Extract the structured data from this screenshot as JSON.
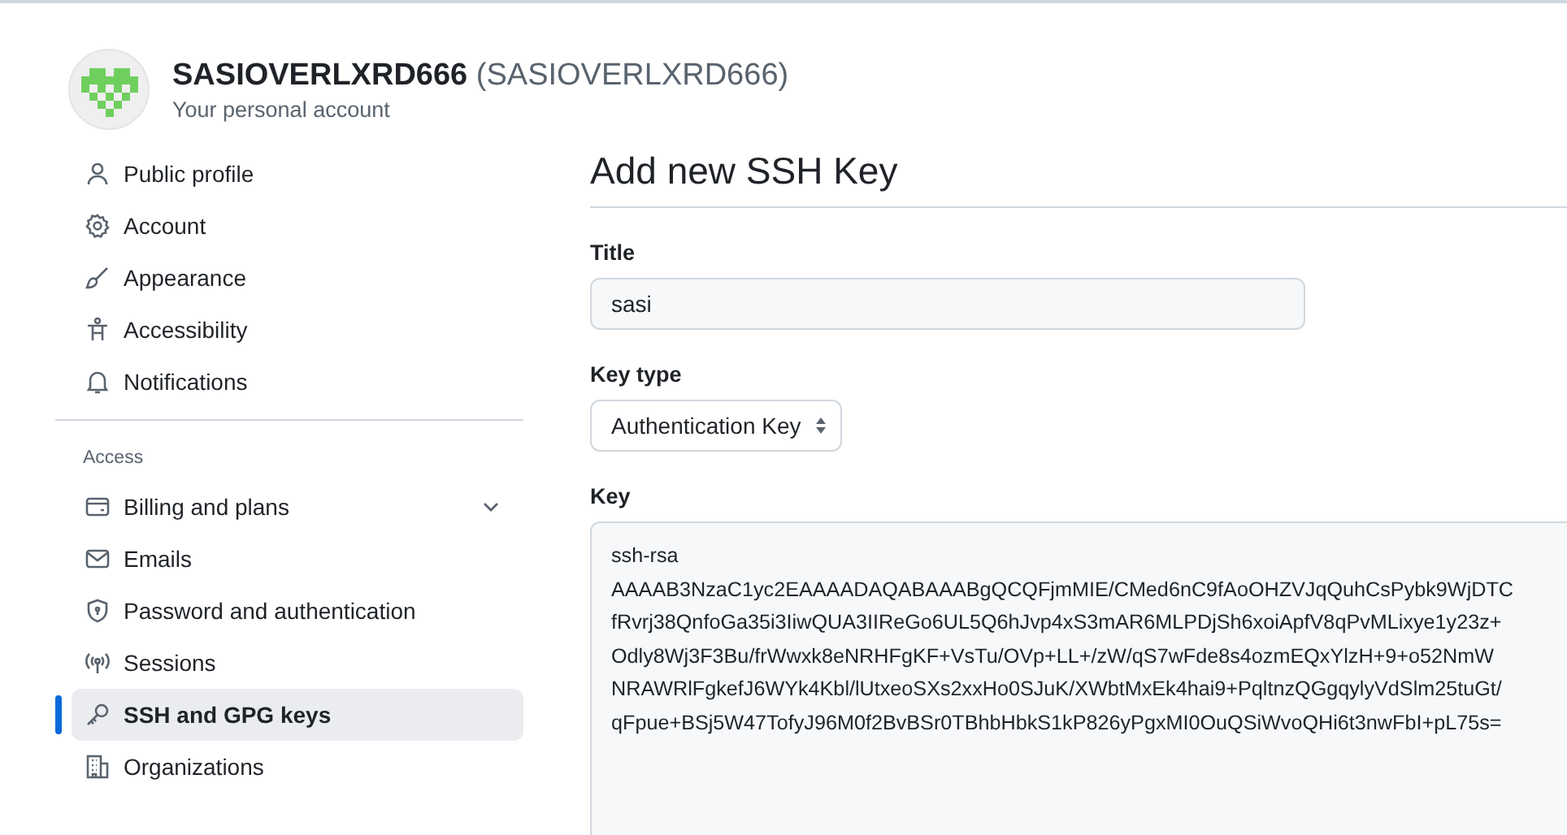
{
  "account": {
    "name": "SASIOVERLXRD666",
    "handle": "(SASIOVERLXRD666)",
    "subtitle": "Your personal account"
  },
  "sidebar": {
    "items": [
      {
        "label": "Public profile",
        "selected": false
      },
      {
        "label": "Account",
        "selected": false
      },
      {
        "label": "Appearance",
        "selected": false
      },
      {
        "label": "Accessibility",
        "selected": false
      },
      {
        "label": "Notifications",
        "selected": false
      },
      {
        "kind": "heading",
        "label": "Access"
      },
      {
        "label": "Billing and plans",
        "selected": false,
        "expandable": true
      },
      {
        "label": "Emails",
        "selected": false
      },
      {
        "label": "Password and authentication",
        "selected": false
      },
      {
        "label": "Sessions",
        "selected": false
      },
      {
        "label": "SSH and GPG keys",
        "selected": true
      },
      {
        "label": "Organizations",
        "selected": false
      }
    ]
  },
  "form": {
    "heading": "Add new SSH Key",
    "title_field": {
      "label": "Title",
      "value": "sasi"
    },
    "key_type": {
      "label": "Key type",
      "value": "Authentication Key"
    },
    "key_field": {
      "label": "Key",
      "lines": [
        "ssh-rsa",
        "AAAAB3NzaC1yc2EAAAADAQABAAABgQCQFjmMIE/CMed6nC9fAoOHZVJqQuhCsPybk9WjDTC",
        "fRvrj38QnfoGa35i3IiwQUA3IIReGo6UL5Q6hJvp4xS3mAR6MLPDjSh6xoiApfV8qPvMLixye1y23z+",
        "Odly8Wj3F3Bu/frWwxk8eNRHFgKF+VsTu/OVp+LL+/zW/qS7wFde8s4ozmEQxYlzH+9+o52NmW",
        "NRAWRlFgkefJ6WYk4Kbl/lUtxeoSXs2xxHo0SJuK/XWbtMxEk4hai9+PqltnzQGgqylyVdSlm25tuGt/",
        "qFpue+BSj5W47TofyJ96M0f2BvBSr0TBhbHbkS1kP826yPgxMI0OuQSiWvoQHi6t3nwFbI+pL75s="
      ]
    }
  }
}
